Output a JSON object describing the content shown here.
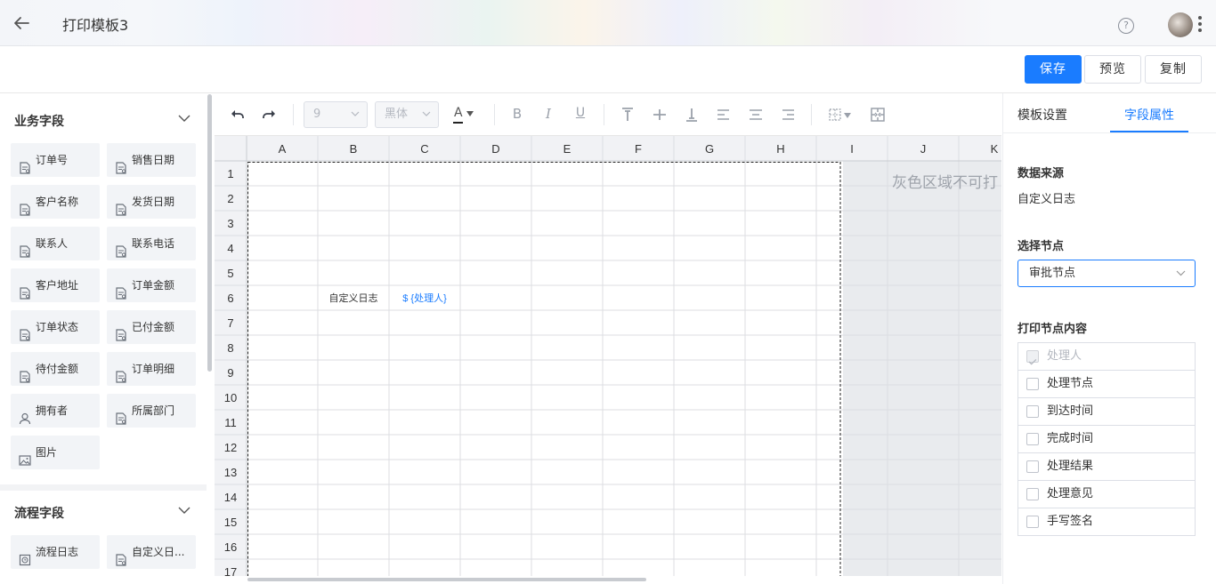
{
  "header": {
    "title": "打印模板3",
    "help_glyph": "?"
  },
  "actions": {
    "save": "保存",
    "preview": "预览",
    "copy": "复制"
  },
  "left_panel": {
    "business_section": {
      "title": "业务字段",
      "items": [
        {
          "label": "订单号",
          "icon": "form-field-icon"
        },
        {
          "label": "销售日期",
          "icon": "form-field-icon"
        },
        {
          "label": "客户名称",
          "icon": "form-field-icon"
        },
        {
          "label": "发货日期",
          "icon": "form-field-icon"
        },
        {
          "label": "联系人",
          "icon": "form-field-icon"
        },
        {
          "label": "联系电话",
          "icon": "form-field-icon"
        },
        {
          "label": "客户地址",
          "icon": "form-field-icon"
        },
        {
          "label": "订单金额",
          "icon": "form-field-icon"
        },
        {
          "label": "订单状态",
          "icon": "form-field-icon"
        },
        {
          "label": "已付金额",
          "icon": "form-field-icon"
        },
        {
          "label": "待付金额",
          "icon": "form-field-icon"
        },
        {
          "label": "订单明细",
          "icon": "form-field-icon"
        },
        {
          "label": "拥有者",
          "icon": "user-icon"
        },
        {
          "label": "所属部门",
          "icon": "form-field-icon"
        },
        {
          "label": "图片",
          "icon": "image-icon"
        }
      ]
    },
    "process_section": {
      "title": "流程字段",
      "items": [
        {
          "label": "流程日志",
          "icon": "log-icon"
        },
        {
          "label": "自定义日...",
          "icon": "form-field-icon"
        }
      ]
    }
  },
  "toolbar": {
    "font_size": "9",
    "font_family": "黑体",
    "font_color_glyph": "A",
    "bold_glyph": "B",
    "italic_glyph": "I",
    "underline_glyph": "U",
    "accent_color": "#1a7cff"
  },
  "sheet": {
    "columns": [
      "A",
      "B",
      "C",
      "D",
      "E",
      "F",
      "G",
      "H",
      "I",
      "J",
      "K"
    ],
    "rows": [
      "1",
      "2",
      "3",
      "4",
      "5",
      "6",
      "7",
      "8",
      "9",
      "10",
      "11",
      "12",
      "13",
      "14",
      "15",
      "16",
      "17"
    ],
    "cells": [
      {
        "row": "6",
        "col": "B",
        "text": "自定义日志",
        "color": "#333333"
      },
      {
        "row": "6",
        "col": "C",
        "text": "$ {处理人}",
        "color": "#1a7cff"
      }
    ],
    "gray_area_text": "灰色区域不可打"
  },
  "right_panel": {
    "tabs": [
      "模板设置",
      "字段属性"
    ],
    "active_tab": "字段属性",
    "data_source_label": "数据来源",
    "data_source_value": "自定义日志",
    "node_label": "选择节点",
    "node_value": "审批节点",
    "print_content_label": "打印节点内容",
    "options": [
      {
        "label": "处理人",
        "checked": true,
        "disabled": true
      },
      {
        "label": "处理节点",
        "checked": false,
        "disabled": false
      },
      {
        "label": "到达时间",
        "checked": false,
        "disabled": false
      },
      {
        "label": "完成时间",
        "checked": false,
        "disabled": false
      },
      {
        "label": "处理结果",
        "checked": false,
        "disabled": false
      },
      {
        "label": "处理意见",
        "checked": false,
        "disabled": false
      },
      {
        "label": "手写签名",
        "checked": false,
        "disabled": false
      }
    ]
  }
}
